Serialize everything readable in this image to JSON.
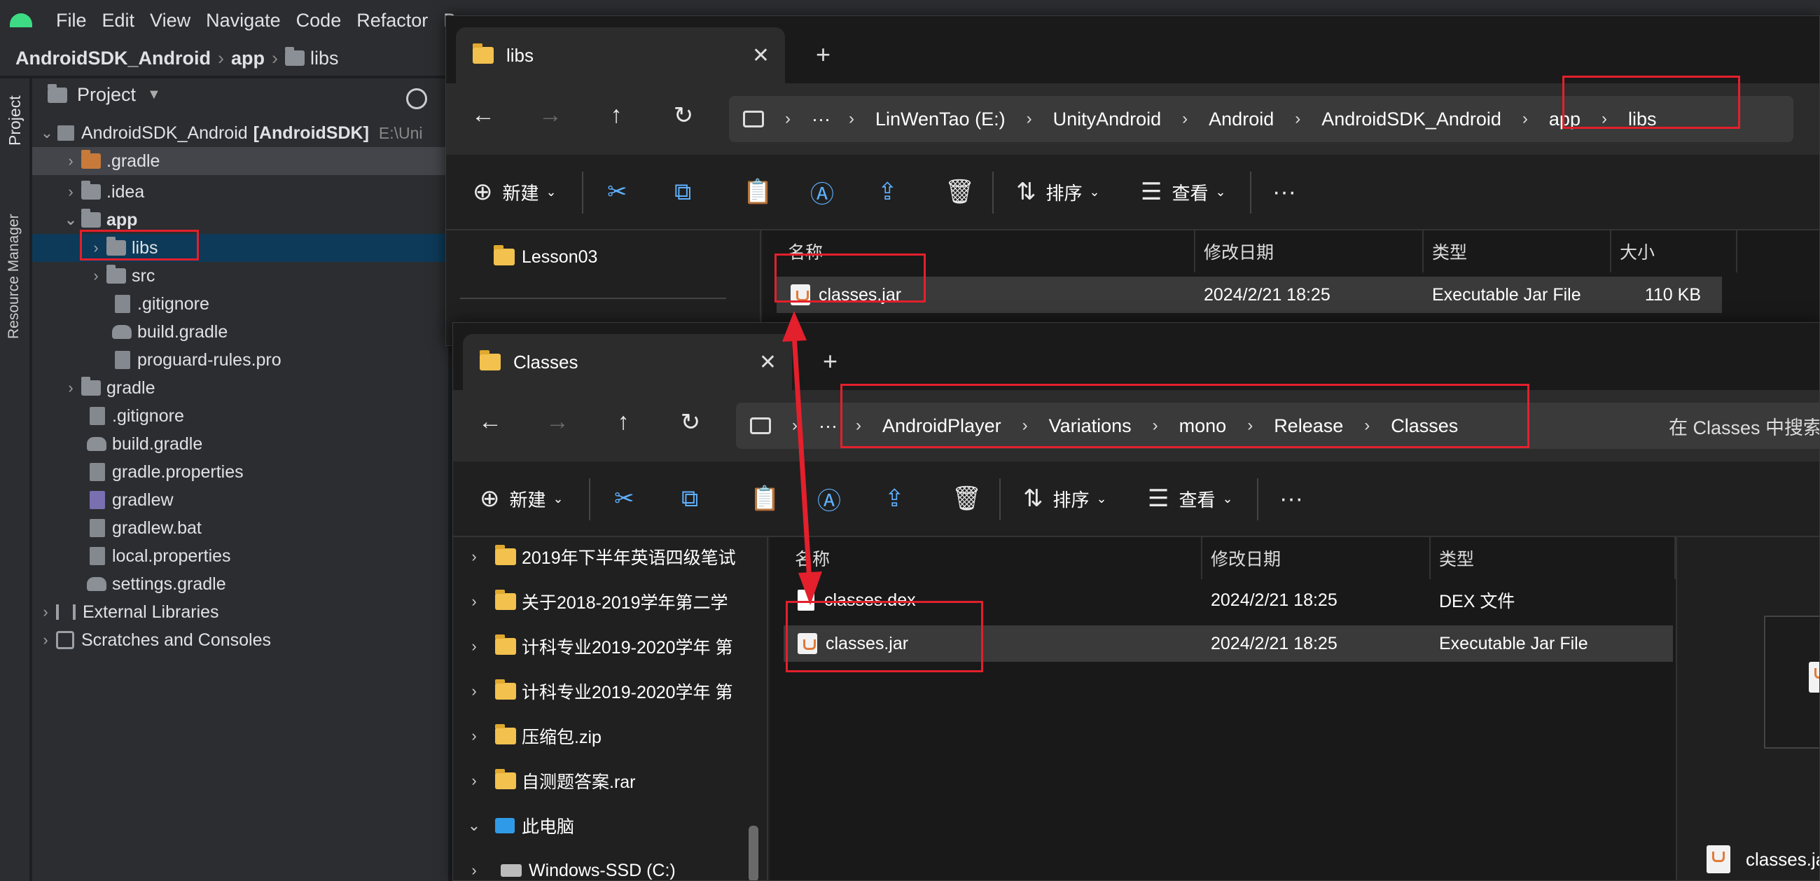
{
  "ide": {
    "menus": [
      "File",
      "Edit",
      "View",
      "Navigate",
      "Code",
      "Refactor",
      "B"
    ],
    "breadcrumb": [
      "AndroidSDK_Android",
      "app",
      "libs"
    ],
    "side_tabs": [
      "Project",
      "Resource Manager"
    ],
    "project_panel": {
      "title": "Project",
      "root_name": "AndroidSDK_Android",
      "root_module": "[AndroidSDK]",
      "root_path": "E:\\Uni",
      "items": [
        {
          "label": "gradle-dir",
          "text": ".gradle"
        },
        {
          "label": "idea-dir",
          "text": ".idea"
        },
        {
          "label": "app-dir",
          "text": "app"
        },
        {
          "label": "libs-dir",
          "text": "libs"
        },
        {
          "label": "src-dir",
          "text": "src"
        },
        {
          "label": "gitignore-app",
          "text": ".gitignore"
        },
        {
          "label": "build-gradle-app",
          "text": "build.gradle"
        },
        {
          "label": "proguard",
          "text": "proguard-rules.pro"
        },
        {
          "label": "gradle-folder",
          "text": "gradle"
        },
        {
          "label": "gitignore-root",
          "text": ".gitignore"
        },
        {
          "label": "build-gradle-root",
          "text": "build.gradle"
        },
        {
          "label": "gradle-properties",
          "text": "gradle.properties"
        },
        {
          "label": "gradlew",
          "text": "gradlew"
        },
        {
          "label": "gradlew-bat",
          "text": "gradlew.bat"
        },
        {
          "label": "local-properties",
          "text": "local.properties"
        },
        {
          "label": "settings-gradle",
          "text": "settings.gradle"
        },
        {
          "label": "external-libraries",
          "text": "External Libraries"
        },
        {
          "label": "scratches",
          "text": "Scratches and Consoles"
        }
      ]
    }
  },
  "explorer_libs": {
    "tab_title": "libs",
    "address": [
      "LinWenTao (E:)",
      "UnityAndroid",
      "Android",
      "AndroidSDK_Android",
      "app",
      "libs"
    ],
    "toolbar": {
      "new": "新建",
      "sort": "排序",
      "view": "查看"
    },
    "nav_tree": [
      "Lesson03"
    ],
    "columns": [
      "名称",
      "修改日期",
      "类型",
      "大小"
    ],
    "files": [
      {
        "name": "classes.jar",
        "date": "2024/2/21 18:25",
        "type": "Executable Jar File",
        "size": "110 KB"
      }
    ]
  },
  "explorer_classes": {
    "tab_title": "Classes",
    "address": [
      "AndroidPlayer",
      "Variations",
      "mono",
      "Release",
      "Classes"
    ],
    "search_placeholder": "在 Classes 中搜索",
    "toolbar": {
      "new": "新建",
      "sort": "排序",
      "view": "查看"
    },
    "nav_tree": [
      "2019年下半年英语四级笔试",
      "关于2018-2019学年第二学",
      "计科专业2019-2020学年 第",
      "计科专业2019-2020学年 第",
      "压缩包.zip",
      "自测题答案.rar",
      "此电脑",
      "Windows-SSD (C:)"
    ],
    "columns": [
      "名称",
      "修改日期",
      "类型"
    ],
    "files": [
      {
        "name": "classes.dex",
        "date": "2024/2/21 18:25",
        "type": "DEX 文件"
      },
      {
        "name": "classes.jar",
        "date": "2024/2/21 18:25",
        "type": "Executable Jar File"
      }
    ],
    "preview_caption": "classes.jar"
  },
  "icons": [
    "android-icon",
    "folder-icon",
    "close-icon",
    "plus-icon",
    "back-arrow-icon",
    "forward-arrow-icon",
    "up-arrow-icon",
    "refresh-icon",
    "computer-icon",
    "cut-icon",
    "copy-icon",
    "paste-icon",
    "rename-icon",
    "share-icon",
    "delete-icon",
    "sort-icon",
    "view-icon",
    "more-icon",
    "jar-file-icon"
  ],
  "colors": {
    "highlight_red": "#e3202c",
    "arrow_red": "#e3202c",
    "folder_yellow": "#f2c14e",
    "ide_selection": "#0d3a58"
  }
}
